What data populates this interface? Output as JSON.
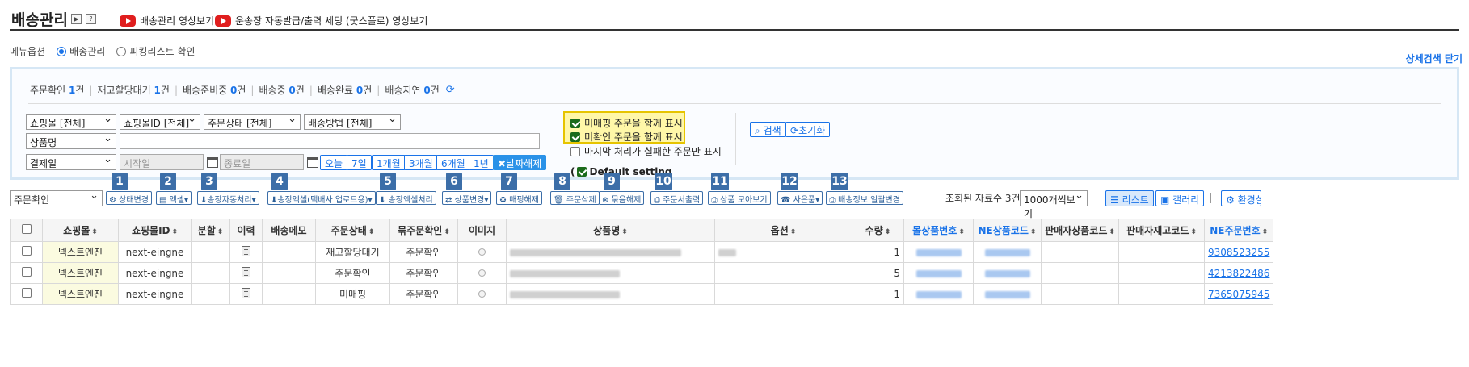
{
  "header": {
    "title": "배송관리",
    "video1": "배송관리 영상보기",
    "video2": "운송장 자동발급/출력 세팅 (굿스플로) 영상보기",
    "btn_play": "▶",
    "btn_help": "?"
  },
  "menu": {
    "label": "메뉴옵션",
    "opt1": "배송관리",
    "opt2": "피킹리스트 확인",
    "detail_close": "상세검색 닫기"
  },
  "status": {
    "items": [
      {
        "label": "주문확인",
        "count": "1",
        "unit": "건"
      },
      {
        "label": "재고할당대기",
        "count": "1",
        "unit": "건"
      },
      {
        "label": "배송준비중",
        "count": "0",
        "unit": "건"
      },
      {
        "label": "배송중",
        "count": "0",
        "unit": "건"
      },
      {
        "label": "배송완료",
        "count": "0",
        "unit": "건"
      },
      {
        "label": "배송지연",
        "count": "0",
        "unit": "건"
      }
    ]
  },
  "filters": {
    "shop": "쇼핑몰 [전체]",
    "shop_id": "쇼핑몰ID [전체]",
    "order_status": "주문상태 [전체]",
    "ship_method": "배송방법 [전체]",
    "product_field": "상품명",
    "date_field": "결제일",
    "start_placeholder": "시작일",
    "end_placeholder": "종료일",
    "date_btns": [
      "오늘",
      "7일",
      "1개월",
      "3개월",
      "6개월",
      "1년"
    ],
    "date_clear": "✖날짜해제",
    "chk1": "미매핑 주문을 함께 표시",
    "chk2": "미확인 주문을 함께 표시",
    "chk3": "마지막 처리가 실패한 주문만 표시",
    "search": "검색",
    "reset": "초기화",
    "default_setting": "Default setting"
  },
  "toolbar": {
    "status_select": "주문확인",
    "buttons": [
      {
        "num": "1",
        "label": "⚙ 상태변경"
      },
      {
        "num": "2",
        "label": "▤ 엑셀▾"
      },
      {
        "num": "3",
        "label": "⬇송장자동처리▾"
      },
      {
        "num": "4",
        "label": "⬇송장엑셀(택배사 업로드용)▾"
      },
      {
        "num": "5",
        "label": "⬇ 송장엑셀처리"
      },
      {
        "num": "6",
        "label": "⇄ 상품변경▾"
      },
      {
        "num": "7",
        "label": "♻ 매핑해제"
      },
      {
        "num": "8",
        "label": "🗑 주문삭제"
      },
      {
        "num": "9",
        "label": "⊗ 묶음해제"
      },
      {
        "num": "10",
        "label": "⎙ 주문서출력"
      },
      {
        "num": "11",
        "label": "⎙ 상품 모아보기"
      },
      {
        "num": "12",
        "label": "☎ 사은품▾"
      },
      {
        "num": "13",
        "label": "⎙ 배송정보 일괄변경"
      }
    ],
    "count_label": "조회된 자료수 3건",
    "page_size": "1000개씩보기",
    "view_list": "☰ 리스트",
    "view_gallery": "▣ 갤러리",
    "env_setting": "⚙ 환경설"
  },
  "table": {
    "headers": [
      "쇼핑몰",
      "쇼핑몰ID",
      "분할",
      "이력",
      "배송메모",
      "주문상태",
      "묶주문확인",
      "이미지",
      "상품명",
      "옵션",
      "수량",
      "몰상품번호",
      "NE상품코드",
      "판매자상품코드",
      "판매자재고코드",
      "NE주문번호"
    ],
    "rows": [
      {
        "shop": "넥스트엔진",
        "shop_id": "next-eingne",
        "status": "재고할당대기",
        "confirm": "주문확인",
        "qty": "1",
        "order_no": "9308523255"
      },
      {
        "shop": "넥스트엔진",
        "shop_id": "next-eingne",
        "status": "주문확인",
        "confirm": "주문확인",
        "qty": "5",
        "order_no": "4213822486"
      },
      {
        "shop": "넥스트엔진",
        "shop_id": "next-eingne",
        "status": "미매핑",
        "confirm": "주문확인",
        "qty": "1",
        "order_no": "7365075945"
      }
    ]
  }
}
